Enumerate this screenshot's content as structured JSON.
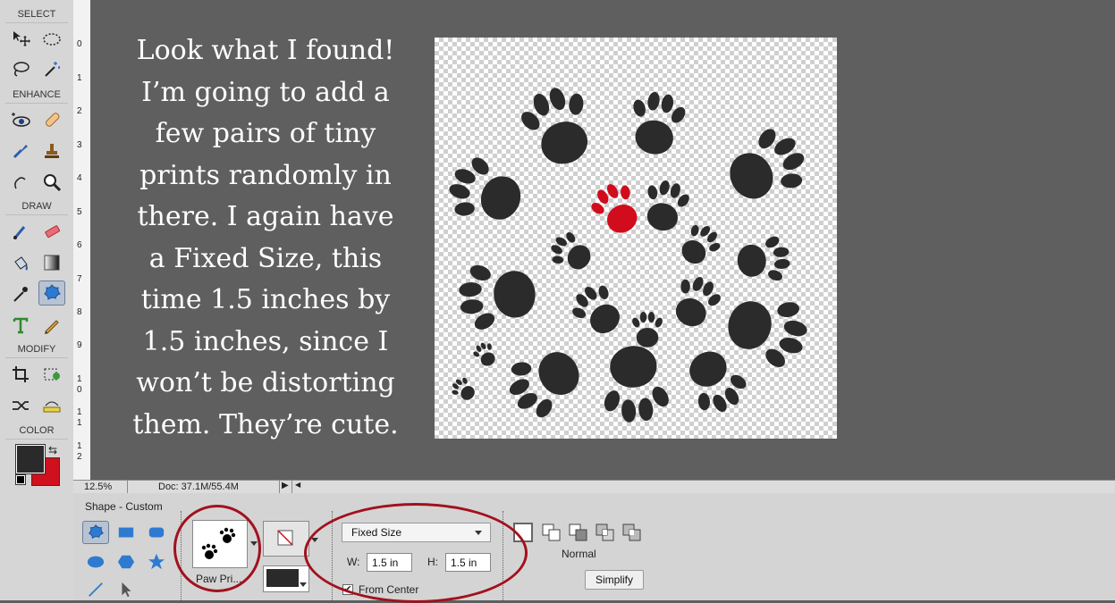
{
  "toolbox": {
    "sections": [
      "SELECT",
      "ENHANCE",
      "DRAW",
      "MODIFY",
      "COLOR"
    ],
    "foreground_color": "#2a2a2a",
    "background_color": "#d0101c"
  },
  "ruler": {
    "ticks": [
      "0",
      "1",
      "2",
      "3",
      "4",
      "5",
      "6",
      "7",
      "8",
      "9",
      "1\n0",
      "1\n1",
      "1\n2"
    ]
  },
  "caption": {
    "lines": [
      "Look what I found!",
      "I’m going to add a",
      "few pairs of tiny",
      "prints randomly in",
      "there. I again have",
      "a Fixed Size, this",
      "time 1.5 inches by",
      "1.5 inches, since I",
      "won’t be distorting",
      "them. They’re cute."
    ]
  },
  "statusbar": {
    "zoom": "12.5%",
    "doc": "Doc: 37.1M/55.4M"
  },
  "options": {
    "title": "Shape - Custom",
    "shape_preview_label": "Paw Pri...",
    "geometry_select": "Fixed Size",
    "width_label": "W:",
    "width_value": "1.5 in",
    "height_label": "H:",
    "height_value": "1.5 in",
    "from_center_label": "From Center",
    "from_center_checked": true,
    "mode_label": "Normal",
    "simplify_label": "Simplify",
    "shape_fill_color": "#2a2a2a"
  },
  "annotation_color": "#a1111d",
  "paw_colors": {
    "dark": "#2b2b2b",
    "red": "#d10c1c"
  }
}
